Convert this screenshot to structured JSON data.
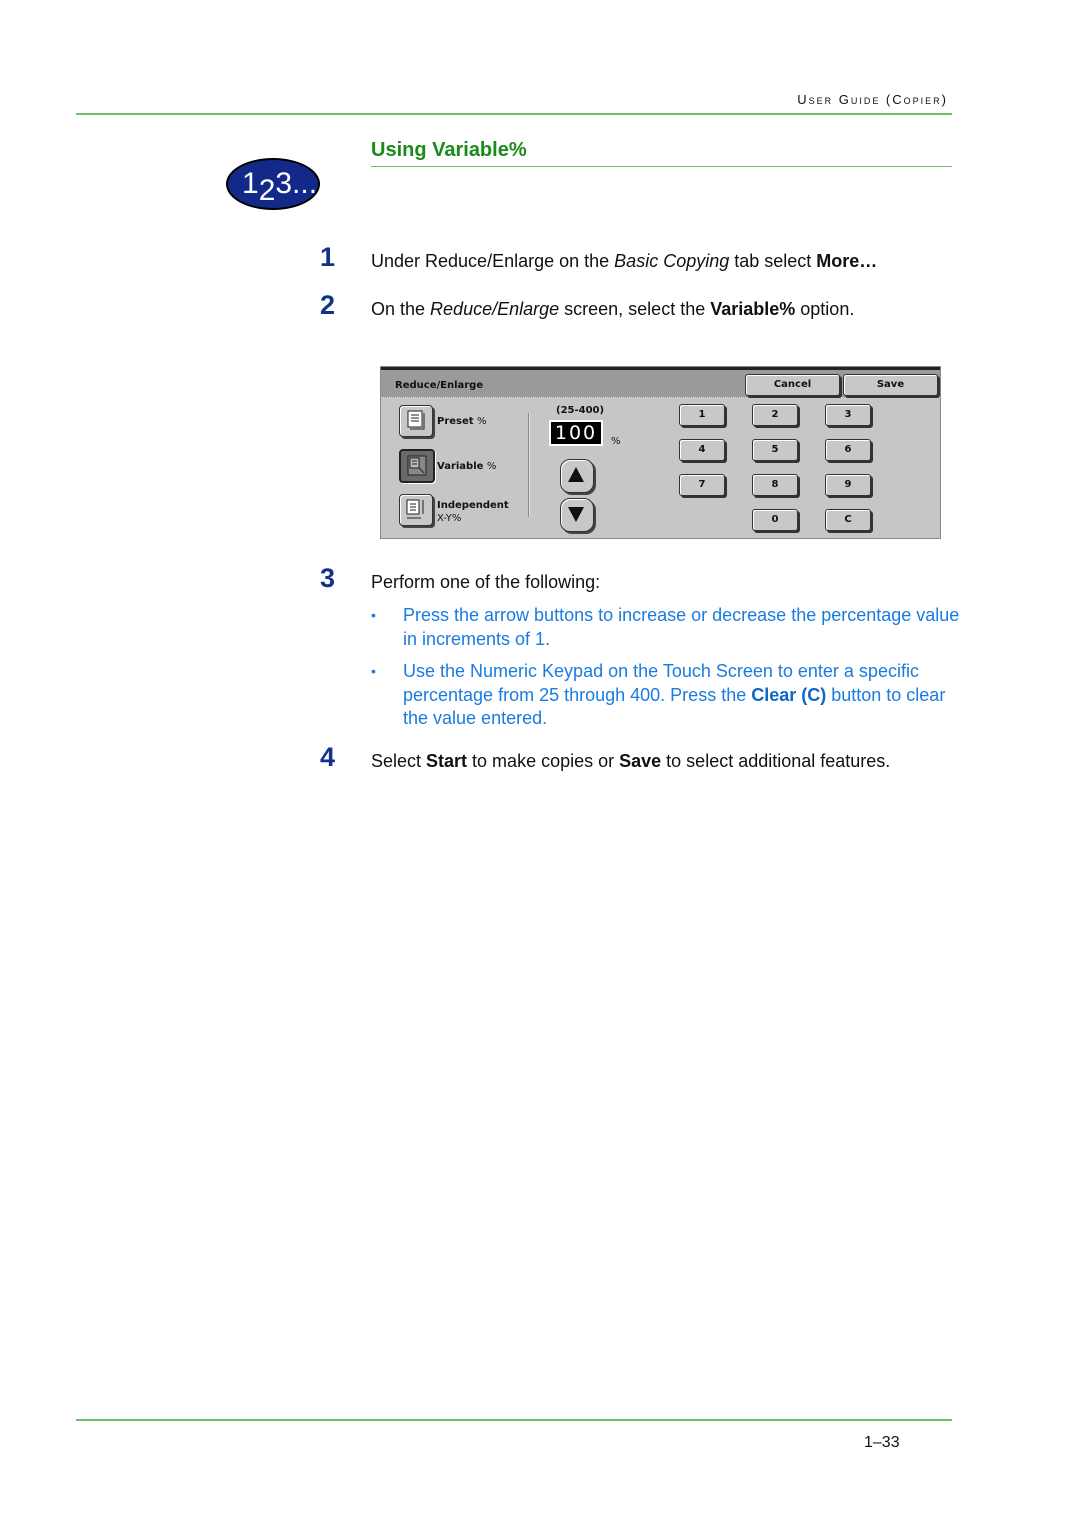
{
  "header": {
    "running_title": "User Guide (Copier)",
    "colors": {
      "rule": "#6fbf6a",
      "section_title": "#1a8a1a",
      "step_number": "#10338a",
      "bullet_text": "#1a7be0",
      "badge": "#13298a"
    }
  },
  "badge": {
    "main": "1",
    "sub": "2",
    "rest": "3..."
  },
  "section": {
    "title": "Using Variable%"
  },
  "steps": [
    {
      "number": "1",
      "text_parts": [
        "Under Reduce/Enlarge on the ",
        "Basic Copying",
        " tab select ",
        "More…"
      ]
    },
    {
      "number": "2",
      "text_parts": [
        "On the ",
        "Reduce/Enlarge",
        " screen, select the ",
        "Variable%",
        " option."
      ]
    },
    {
      "number": "3",
      "text": "Perform one of the following:",
      "bullets": [
        {
          "bullet": "•",
          "text": "Press the arrow buttons to increase or decrease the percentage value in increments of 1."
        },
        {
          "bullet": "•",
          "text_parts": [
            "Use the Numeric Keypad on the Touch Screen to enter a specific percentage from 25 through 400.  Press the ",
            "Clear (C)",
            " button to clear the value entered."
          ]
        }
      ]
    },
    {
      "number": "4",
      "text_parts": [
        "Select ",
        "Start",
        " to make copies or ",
        "Save",
        " to select additional features."
      ]
    }
  ],
  "screen": {
    "title": "Reduce/Enlarge",
    "cancel_label": "Cancel",
    "save_label": "Save",
    "options": [
      {
        "label": "Preset",
        "suffix": "%",
        "selected": false
      },
      {
        "label": "Variable",
        "suffix": "%",
        "selected": true
      },
      {
        "label": "Independent",
        "label2": "X-Y%",
        "selected": false
      }
    ],
    "range_label": "(25-400)",
    "value": "100",
    "value_unit": "%",
    "keypad": [
      "1",
      "2",
      "3",
      "4",
      "5",
      "6",
      "7",
      "8",
      "9",
      "0",
      "C"
    ]
  },
  "footer": {
    "page_number": "1–33"
  }
}
